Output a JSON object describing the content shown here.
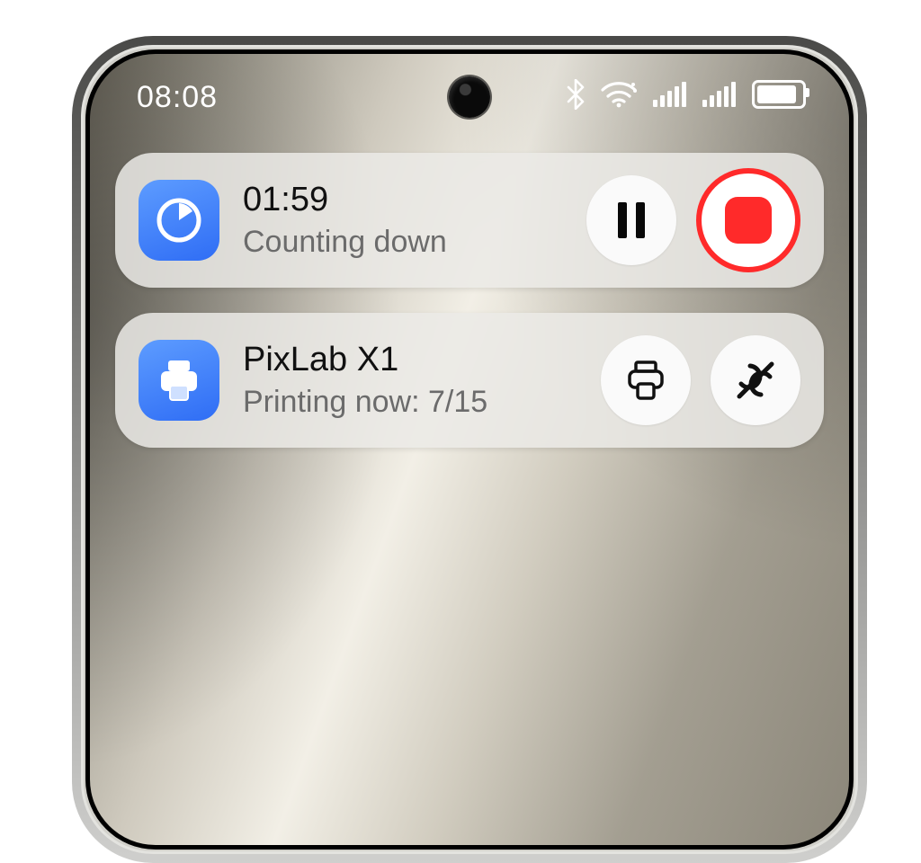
{
  "status_bar": {
    "time": "08:08",
    "icons": [
      "bluetooth",
      "wifi",
      "cellular-1",
      "cellular-2",
      "battery"
    ],
    "battery_level_pct": 80
  },
  "cards": [
    {
      "app_icon": "timer-icon",
      "title": "01:59",
      "subtitle": "Counting down",
      "actions": [
        {
          "name": "pause-button",
          "icon": "pause-icon"
        },
        {
          "name": "stop-button",
          "icon": "stop-icon"
        }
      ]
    },
    {
      "app_icon": "printer-icon",
      "title": "PixLab X1",
      "subtitle": "Printing now:  7/15",
      "actions": [
        {
          "name": "print-button",
          "icon": "print-icon"
        },
        {
          "name": "unlink-button",
          "icon": "unlink-icon"
        }
      ]
    }
  ],
  "accent_color": "#3b78f7"
}
